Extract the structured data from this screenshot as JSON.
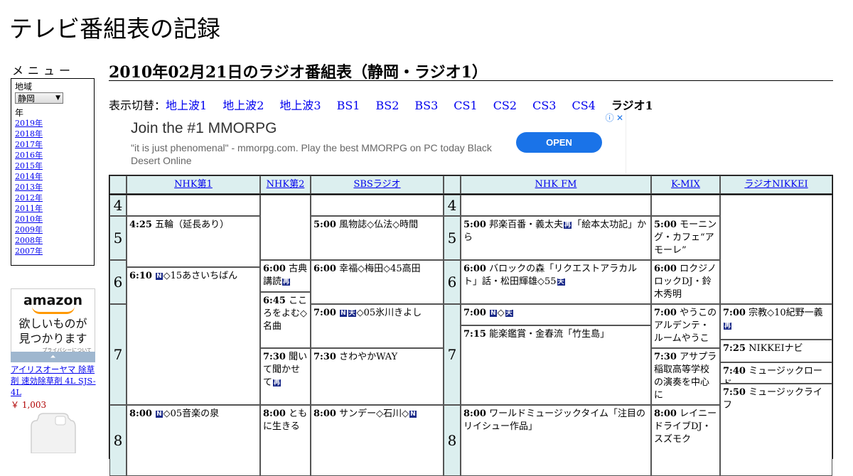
{
  "site": {
    "title": "テレビ番組表の記録"
  },
  "sidebar": {
    "menu_heading": "メニュー",
    "region_label": "地域",
    "region_value": "静岡",
    "year_label": "年",
    "years": [
      "2019年",
      "2018年",
      "2017年",
      "2016年",
      "2015年",
      "2014年",
      "2013年",
      "2012年",
      "2011年",
      "2010年",
      "2009年",
      "2008年",
      "2007年"
    ]
  },
  "amazon_ad": {
    "logo": "amazon",
    "tagline_1": "欲しいものが",
    "tagline_2": "見つかります",
    "privacy": "プライバシーについて",
    "collapse": "⏶",
    "product_title": "アイリスオーヤマ 除草剤 速効除草剤 4L SJS-4L",
    "product_price": "￥ 1,003"
  },
  "main": {
    "heading": "2010年02月21日のラジオ番組表（静岡・ラジオ1）",
    "switch_label": "表示切替：",
    "switch_links": [
      "地上波1",
      "地上波2",
      "地上波3",
      "BS1",
      "BS2",
      "BS3",
      "CS1",
      "CS2",
      "CS3",
      "CS4"
    ],
    "switch_current": "ラジオ1"
  },
  "ad_banner": {
    "headline": "Join the #1 MMORPG",
    "body": "\"it is just phenomenal\" - mmorpg.com. Play the best MMORPG on PC today Black Desert Online",
    "cta": "OPEN",
    "choices": "ⓘ ✕"
  },
  "schedule": {
    "channels": [
      "NHK第1",
      "NHK第2",
      "SBSラジオ",
      "NHK FM",
      "K-MIX",
      "ラジオNIKKEI"
    ],
    "hours": [
      "4",
      "5",
      "6",
      "7",
      "8"
    ],
    "tags": {
      "news": "N",
      "weather": "天",
      "rerun": "再"
    },
    "programs": {
      "nhk1_425": {
        "time": "4:25",
        "title": "五輪（延長あり）"
      },
      "nhk1_610": {
        "time": "6:10",
        "title": "◇15あさいちばん"
      },
      "nhk1_800": {
        "time": "8:00",
        "title": "◇05音楽の泉"
      },
      "nhk2_600": {
        "time": "6:00",
        "title": "古典講読"
      },
      "nhk2_645": {
        "time": "6:45",
        "title": "こころをよむ◇名曲"
      },
      "nhk2_730": {
        "time": "7:30",
        "title": "聞いて聞かせて"
      },
      "nhk2_800": {
        "time": "8:00",
        "title": "ともに生きる"
      },
      "sbs_500": {
        "time": "5:00",
        "title": "風物誌◇仏法◇時間"
      },
      "sbs_600": {
        "time": "6:00",
        "title": "幸福◇梅田◇45高田"
      },
      "sbs_700": {
        "time": "7:00",
        "title": "◇05氷川きよし"
      },
      "sbs_730": {
        "time": "7:30",
        "title": "さわやかWAY"
      },
      "sbs_800": {
        "time": "8:00",
        "title": "サンデー◇石川◇"
      },
      "fm_500": {
        "time": "5:00",
        "title": "邦楽百番・義太夫",
        "title2": "「絵本太功記」から"
      },
      "fm_600": {
        "time": "6:00",
        "title": "バロックの森「リクエストアラカルト」話・松田輝雄◇55"
      },
      "fm_700": {
        "time": "7:00",
        "title": "◇"
      },
      "fm_715": {
        "time": "7:15",
        "title": "能楽鑑賞・金春流「竹生島」"
      },
      "fm_800": {
        "time": "8:00",
        "title": "ワールドミュージックタイム「注目のリイシュー作品」"
      },
      "kmix_500": {
        "time": "5:00",
        "title": "モーニング・カフェ“アモーレ”"
      },
      "kmix_600": {
        "time": "6:00",
        "title": "ロクジノロックDJ・鈴木秀明"
      },
      "kmix_700": {
        "time": "7:00",
        "title": "やうこのアルデンテ・ルームやうこ"
      },
      "kmix_730": {
        "time": "7:30",
        "title": "アサプラ稲取高等学校の演奏を中心に"
      },
      "kmix_800": {
        "time": "8:00",
        "title": "レイニードライブDJ・スズモク"
      },
      "nikkei_700": {
        "time": "7:00",
        "title": "宗教◇10紀野一義"
      },
      "nikkei_725": {
        "time": "7:25",
        "title": "NIKKEIナビ"
      },
      "nikkei_740": {
        "time": "7:40",
        "title": "ミュージックロード"
      },
      "nikkei_750": {
        "time": "7:50",
        "title": "ミュージックライフ"
      }
    }
  }
}
